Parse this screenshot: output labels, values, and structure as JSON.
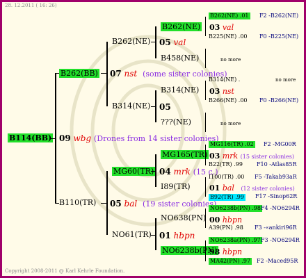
{
  "header": {
    "date": "28. 12.2011 ( 16: 26)"
  },
  "footer": {
    "copyright": "Copyright 2008-2011 @ Karl Kehrle Foundation."
  },
  "root": {
    "id": "B114(BB)"
  },
  "gen1": [
    {
      "id": "B262(BB)",
      "num": "07",
      "code": "nst",
      "note": "(some sister colonies)"
    },
    {
      "id": "B110(TR)",
      "num": "05",
      "code": "bal",
      "note": "(19 sister colonies)"
    }
  ],
  "root_parent": {
    "num": "09",
    "code": "wbg",
    "note": "(Drones from 14 sister colonies)"
  },
  "gen2": [
    {
      "id": "B262(NE)",
      "num": "05",
      "code": "val"
    },
    {
      "id": "B314(NE)",
      "num": "05",
      "code": ""
    },
    {
      "id": "MG60(TR)",
      "num": "04",
      "code": "mrk",
      "note": "(15 c.)"
    },
    {
      "id": "NO61(TR)",
      "num": "01",
      "code": "hbpn"
    }
  ],
  "gen3": [
    {
      "id": "B262(NE)",
      "num": "03",
      "code": "val"
    },
    {
      "id": "B458(NE)",
      "none": "no more"
    },
    {
      "id": "B314(NE)",
      "num": "03",
      "code": "nst"
    },
    {
      "id": "???(NE)",
      "none": "no more"
    },
    {
      "id": "MG165(TR)",
      "num": "03",
      "code": "mrk",
      "note": "(15 sister colonies)"
    },
    {
      "id": "I89(TR)",
      "num": "01",
      "code": "bal",
      "note": "(12 sister colonies)"
    },
    {
      "id": "NO638(PN)",
      "num": "00",
      "code": "hbpn"
    },
    {
      "id": "NO6238b(PN)",
      "num": "98",
      "code": "hbpn"
    }
  ],
  "gen4": [
    {
      "left": "B262(NE) .01",
      "right": "F2 -B262(NE)"
    },
    {
      "left": "B225(NE) .00",
      "right": "F0 -B225(NE)"
    },
    {
      "left": "B314(NE) .",
      "right": "no more"
    },
    {
      "left": "B266(NE) .00",
      "right": "F0 -B266(NE)"
    },
    {
      "left": "MG116(TR) .02",
      "right": "F2 -MG00R"
    },
    {
      "left": "B22(TR) .99",
      "right": "F10 -Atlas85R"
    },
    {
      "left": "I100(TR) .00",
      "right": "F5 -Takab93aR"
    },
    {
      "left": "B92(TR) .99",
      "right": "F17 -Sinop62R"
    },
    {
      "left": "NO6238b(PN) .98",
      "right": "F4 -NO6294R"
    },
    {
      "left": "A39(PN) .98",
      "right": "F3 -«ankiri96R"
    },
    {
      "left": "NO6238a(PN) .97",
      "right": "F3 -NO6294R"
    },
    {
      "left": "MA42(PN) .97",
      "right": "F2 -Maced95R"
    }
  ]
}
